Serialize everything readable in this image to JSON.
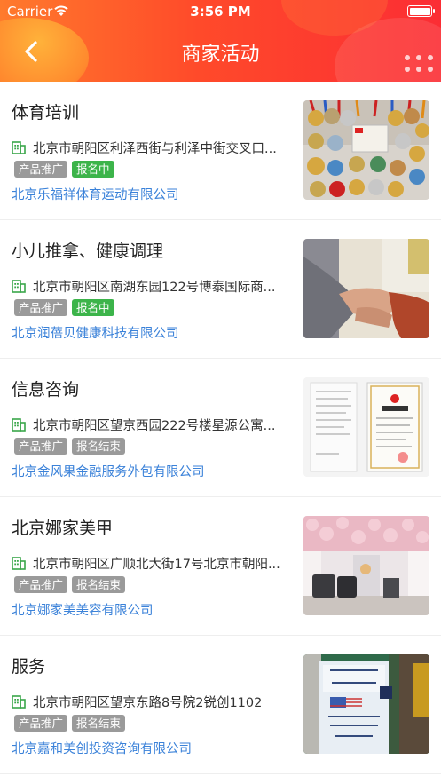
{
  "status_bar": {
    "carrier": "Carrier",
    "time": "3:56 PM"
  },
  "header": {
    "title": "商家活动",
    "back_icon": "chevron-left-icon"
  },
  "colors": {
    "header_start": "#ff7a2c",
    "header_end": "#fb2d34",
    "company_link": "#3b82d9",
    "tag_gray": "#9a9a9a",
    "tag_green": "#3cb44a"
  },
  "items": [
    {
      "title": "体育培训",
      "address": "北京市朝阳区利泽西街与利泽中街交叉口...",
      "tag1": "产品推广",
      "tag2": "报名中",
      "tag2_status": "active",
      "company": "北京乐福祥体育运动有限公司",
      "image": "medals-photo"
    },
    {
      "title": "小儿推拿、健康调理",
      "address": "北京市朝阳区南湖东园122号博泰国际商...",
      "tag1": "产品推广",
      "tag2": "报名中",
      "tag2_status": "active",
      "company": "北京润蓓贝健康科技有限公司",
      "image": "massage-photo"
    },
    {
      "title": "信息咨询",
      "address": "北京市朝阳区望京西园222号楼星源公寓...",
      "tag1": "产品推广",
      "tag2": "报名结束",
      "tag2_status": "ended",
      "company": "北京金风果金融服务外包有限公司",
      "image": "license-photo"
    },
    {
      "title": "北京娜家美甲",
      "address": "北京市朝阳区广顺北大街17号北京市朝阳...",
      "tag1": "产品推广",
      "tag2": "报名结束",
      "tag2_status": "ended",
      "company": "北京娜家美美容有限公司",
      "image": "salon-photo"
    },
    {
      "title": "服务",
      "address": "北京市朝阳区望京东路8号院2锐创1102",
      "tag1": "产品推广",
      "tag2": "报名结束",
      "tag2_status": "ended",
      "company": "北京嘉和美创投资咨询有限公司",
      "image": "vote-sign-photo"
    }
  ]
}
